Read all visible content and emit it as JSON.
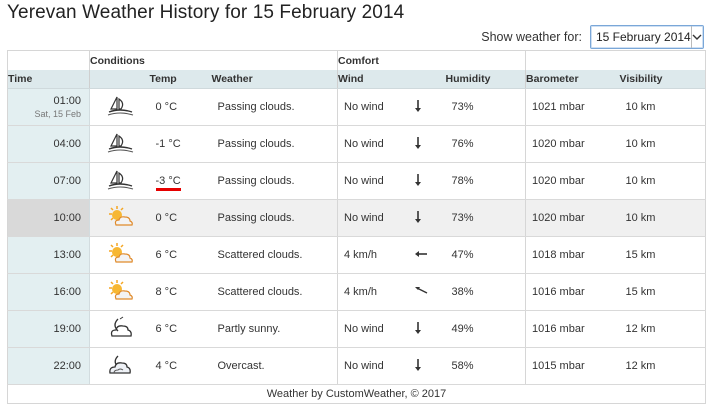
{
  "page": {
    "title": "Yerevan Weather History for 15 February 2014"
  },
  "selector": {
    "label": "Show weather for:",
    "value": "15 February 2014"
  },
  "table": {
    "groups": {
      "conditions": "Conditions",
      "comfort": "Comfort"
    },
    "headers": {
      "time": "Time",
      "temp": "Temp",
      "weather": "Weather",
      "wind": "Wind",
      "humidity": "Humidity",
      "barometer": "Barometer",
      "visibility": "Visibility"
    },
    "rows": [
      {
        "time": "01:00",
        "date": "Sat, 15 Feb",
        "icon": "night-cloud-icon",
        "temp": "0 °C",
        "weather": "Passing clouds.",
        "wind": "No wind",
        "wind_dir": "down",
        "humidity": "73%",
        "barometer": "1021 mbar",
        "visibility": "10 km"
      },
      {
        "time": "04:00",
        "date": "",
        "icon": "night-cloud-icon",
        "temp": "-1 °C",
        "weather": "Passing clouds.",
        "wind": "No wind",
        "wind_dir": "down",
        "humidity": "76%",
        "barometer": "1020 mbar",
        "visibility": "10 km"
      },
      {
        "time": "07:00",
        "date": "",
        "icon": "night-cloud-icon",
        "temp": "-3 °C",
        "weather": "Passing clouds.",
        "wind": "No wind",
        "wind_dir": "down",
        "humidity": "78%",
        "barometer": "1020 mbar",
        "visibility": "10 km"
      },
      {
        "time": "10:00",
        "date": "",
        "icon": "sun-cloud-icon",
        "temp": "0 °C",
        "weather": "Passing clouds.",
        "wind": "No wind",
        "wind_dir": "down",
        "humidity": "73%",
        "barometer": "1020 mbar",
        "visibility": "10 km"
      },
      {
        "time": "13:00",
        "date": "",
        "icon": "sun-cloud-icon",
        "temp": "6 °C",
        "weather": "Scattered clouds.",
        "wind": "4 km/h",
        "wind_dir": "left",
        "humidity": "47%",
        "barometer": "1018 mbar",
        "visibility": "15 km"
      },
      {
        "time": "16:00",
        "date": "",
        "icon": "sun-cloud-icon",
        "temp": "8 °C",
        "weather": "Scattered clouds.",
        "wind": "4 km/h",
        "wind_dir": "upleft",
        "humidity": "38%",
        "barometer": "1016 mbar",
        "visibility": "15 km"
      },
      {
        "time": "19:00",
        "date": "",
        "icon": "night-partly-icon",
        "temp": "6 °C",
        "weather": "Partly sunny.",
        "wind": "No wind",
        "wind_dir": "down",
        "humidity": "49%",
        "barometer": "1016 mbar",
        "visibility": "12 km"
      },
      {
        "time": "22:00",
        "date": "",
        "icon": "night-overcast-icon",
        "temp": "4 °C",
        "weather": "Overcast.",
        "wind": "No wind",
        "wind_dir": "down",
        "humidity": "58%",
        "barometer": "1015 mbar",
        "visibility": "12 km"
      }
    ],
    "highlight_row": 3,
    "marked_temp_row": 2,
    "footer": "Weather by CustomWeather, © 2017"
  },
  "colors": {
    "header_bg": "#dde9ec",
    "time_bg": "#e3eff1",
    "mark": "#e60000",
    "select_border": "#7aa7d8"
  }
}
